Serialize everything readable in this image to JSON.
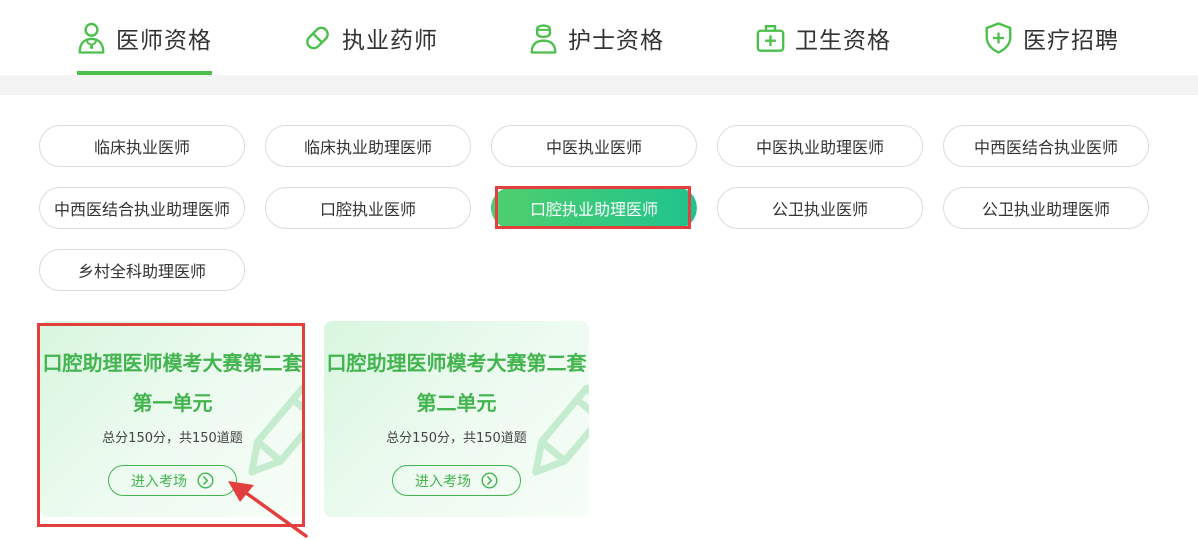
{
  "tabs": [
    {
      "label": "医师资格",
      "icon": "doctor-icon"
    },
    {
      "label": "执业药师",
      "icon": "pill-icon"
    },
    {
      "label": "护士资格",
      "icon": "nurse-icon"
    },
    {
      "label": "卫生资格",
      "icon": "medical-kit-icon"
    },
    {
      "label": "医疗招聘",
      "icon": "shield-plus-icon"
    }
  ],
  "active_tab": "医师资格",
  "categories": [
    "临床执业医师",
    "临床执业助理医师",
    "中医执业医师",
    "中医执业助理医师",
    "中西医结合执业医师",
    "中西医结合执业助理医师",
    "口腔执业医师",
    "口腔执业助理医师",
    "公卫执业医师",
    "公卫执业助理医师",
    "乡村全科助理医师"
  ],
  "active_category": "口腔执业助理医师",
  "cards": [
    {
      "title_line1": "口腔助理医师模考大赛第二套",
      "title_line2": "第一单元",
      "info": "总分150分，共150道题",
      "button": "进入考场"
    },
    {
      "title_line1": "口腔助理医师模考大赛第二套",
      "title_line2": "第二单元",
      "info": "总分150分，共150道题",
      "button": "进入考场"
    }
  ],
  "colors": {
    "accent": "#4cbf4c",
    "highlight": "#e43f3f",
    "pill_gradient_start": "#4fcf6d",
    "pill_gradient_end": "#1fc38e"
  }
}
